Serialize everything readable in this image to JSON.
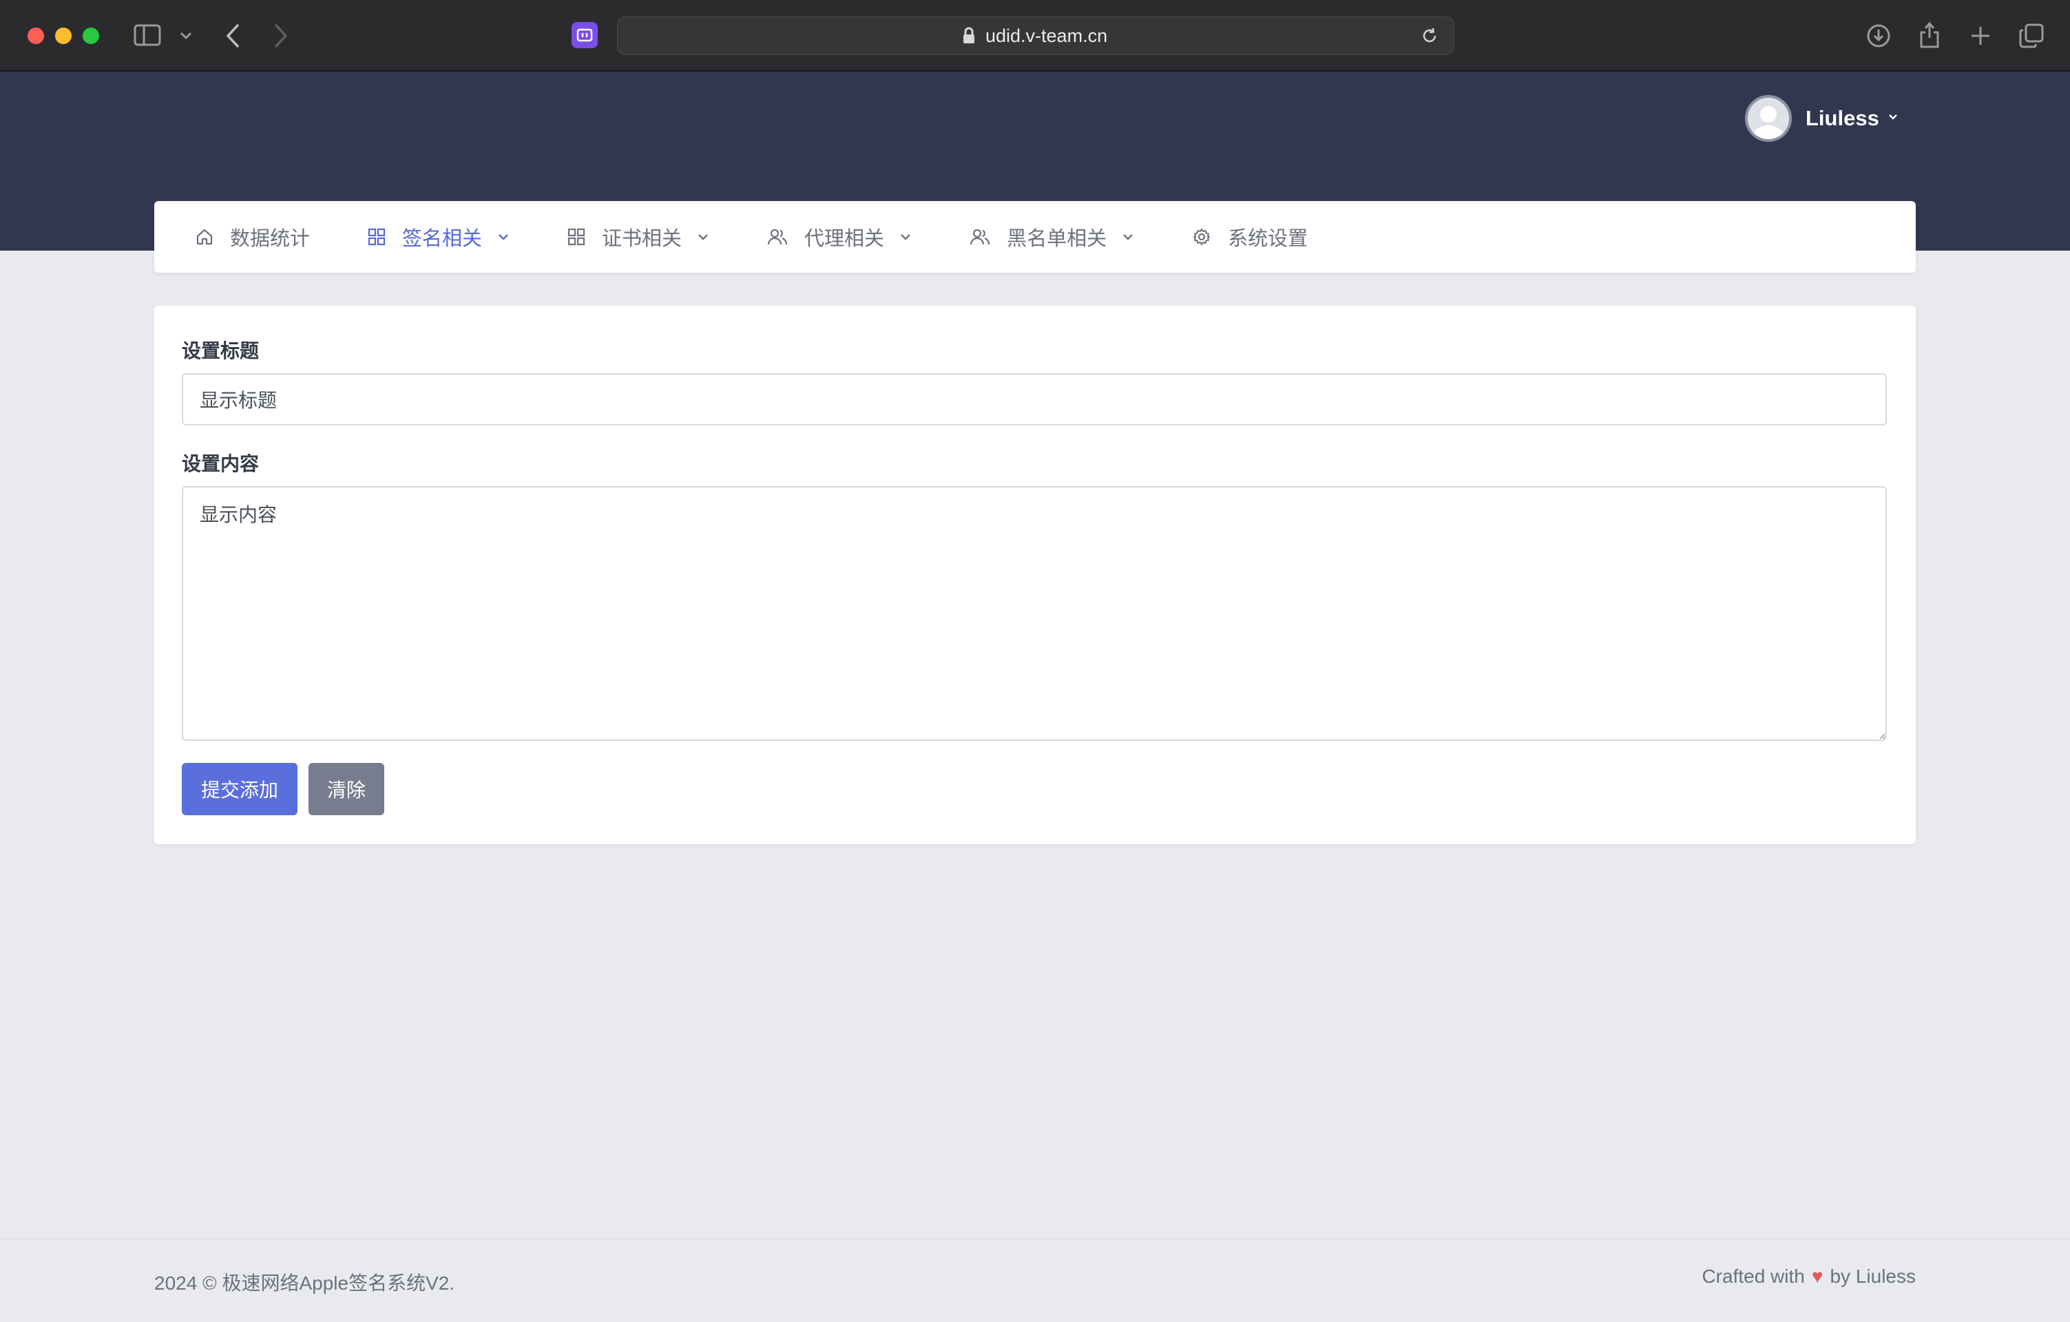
{
  "browser": {
    "url": "udid.v-team.cn"
  },
  "header": {
    "user_name": "Liuless"
  },
  "nav": {
    "items": [
      {
        "label": "数据统计"
      },
      {
        "label": "签名相关"
      },
      {
        "label": "证书相关"
      },
      {
        "label": "代理相关"
      },
      {
        "label": "黑名单相关"
      },
      {
        "label": "系统设置"
      }
    ],
    "active_index": 1
  },
  "form": {
    "title_label": "设置标题",
    "title_value": "显示标题",
    "content_label": "设置内容",
    "content_value": "显示内容",
    "submit_label": "提交添加",
    "clear_label": "清除"
  },
  "footer": {
    "copyright": "2024 © 极速网络Apple签名系统V2.",
    "crafted_prefix": "Crafted with",
    "heart": "♥",
    "crafted_suffix": "by Liuless"
  },
  "colors": {
    "header_bg": "#31374f",
    "accent": "#5468d4",
    "primary_button": "#5b6fdc",
    "secondary_button": "#777c8e",
    "page_bg": "#e9eaef"
  }
}
